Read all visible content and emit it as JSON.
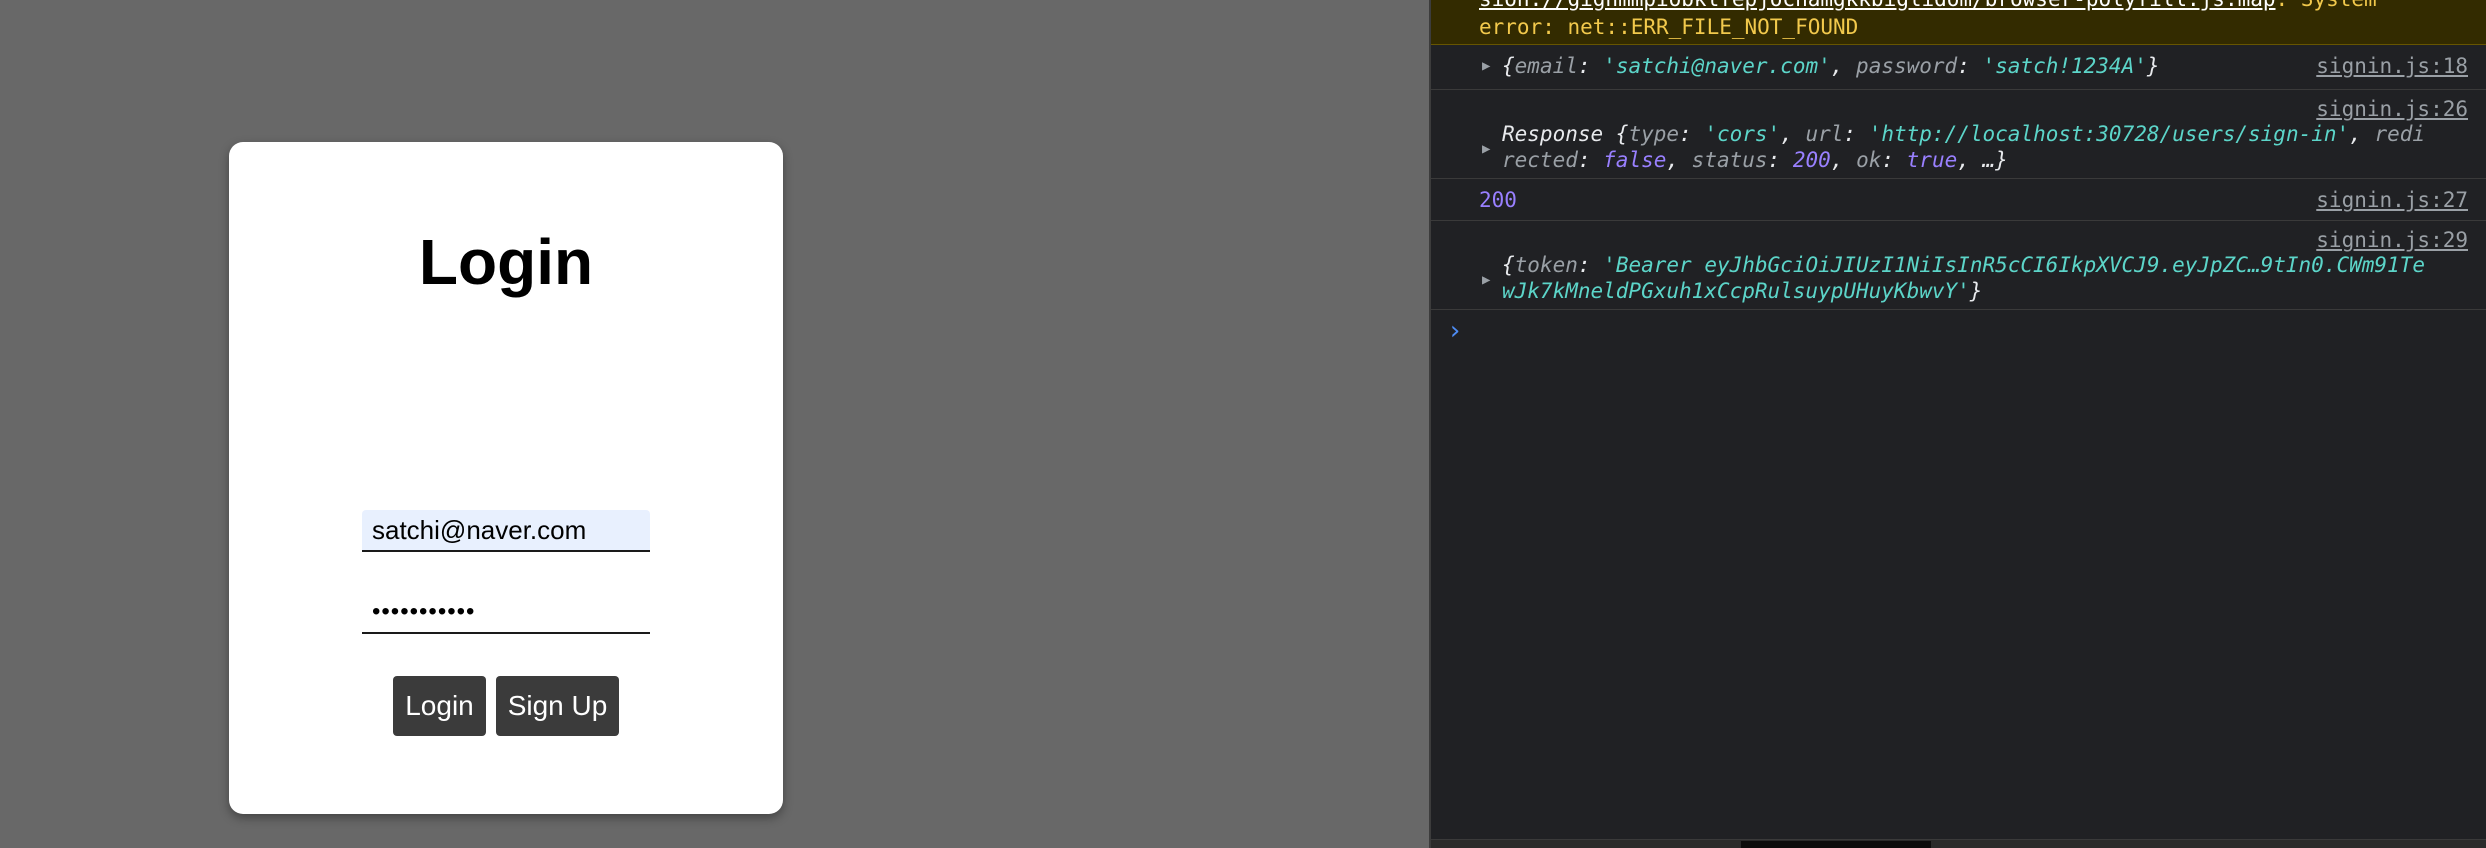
{
  "login": {
    "title": "Login",
    "email_value": "satchi@naver.com",
    "password_value": "satch!1234A",
    "login_button": "Login",
    "signup_button": "Sign Up"
  },
  "console": {
    "warning": {
      "link_text": "sion://gighmmpiobklfepjocnamgkkbiglidom/browser-polyfill.js.map",
      "after_link": ": System",
      "line2": "error: net::ERR_FILE_NOT_FOUND"
    },
    "messages": [
      {
        "source": "signin.js:18",
        "parts": [
          "{",
          "email",
          ": ",
          "'satchi@naver.com'",
          ", ",
          "password",
          ": ",
          "'satch!1234A'",
          "}"
        ]
      },
      {
        "source": "signin.js:26",
        "line1": [
          "Response ",
          "{",
          "type",
          ": ",
          "'cors'",
          ", ",
          "url",
          ": ",
          "'http://localhost:30728/users/sign-in'",
          ", ",
          "redi"
        ],
        "line2": [
          "rected",
          ": ",
          "false",
          ", ",
          "status",
          ": ",
          "200",
          ", ",
          "ok",
          ": ",
          "true",
          ", …}"
        ]
      },
      {
        "source": "signin.js:27",
        "value": "200"
      },
      {
        "source": "signin.js:29",
        "line1": [
          "{",
          "token",
          ": ",
          "'Bearer eyJhbGciOiJIUzI1NiIsInR5cCI6IkpXVCJ9.eyJpZC…9tIn0.CWm91Te"
        ],
        "line2": [
          "wJk7kMneldPGxuh1xCcpRulsuypUHuyKbwvY'",
          "}"
        ]
      }
    ],
    "prompt": "›"
  },
  "icons": {
    "expand": "triangle-right-icon",
    "prompt": "chevron-right-icon"
  },
  "colors": {
    "page_bg": "#686868",
    "card_bg": "#ffffff",
    "button_bg": "#3b3b3b",
    "console_bg": "#202124",
    "warning_bg": "#332b00",
    "warning_text": "#f2c94c",
    "string": "#5cd5c9",
    "number": "#9980ff",
    "email_autofill_bg": "#e8f0fe"
  }
}
